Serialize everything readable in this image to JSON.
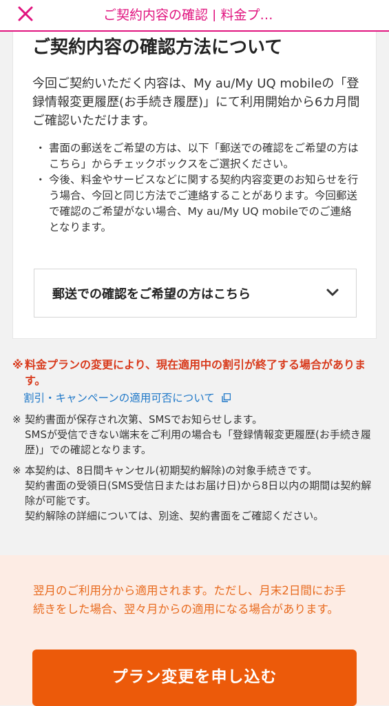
{
  "header": {
    "close_icon": "close-icon",
    "title": "ご契約内容の確認 | 料金プ…"
  },
  "card": {
    "title": "ご契約内容の確認方法について",
    "lead": "今回ご契約いただく内容は、My au/My UQ mobileの「登録情報変更履歴(お手続き履歴)」にて利用開始から6カ月間ご確認いただけます。",
    "bullets": [
      "書面の郵送をご希望の方は、以下「郵送での確認をご希望の方はこちら」からチェックボックスをご選択ください。",
      "今後、料金やサービスなどに関する契約内容変更のお知らせを行う場合、今回と同じ方法でご連絡することがあります。今回郵送で確認のご希望がない場合、My au/My UQ mobileでのご連絡となります。"
    ],
    "bullet_mark": "・",
    "accordion_label": "郵送での確認をご希望の方はこちら",
    "accordion_icon": "chevron-down-icon"
  },
  "notes": {
    "mark": "※",
    "warning": "料金プランの変更により、現在適用中の割引が終了する場合があります。",
    "link_text": "割引・キャンペーンの適用可否について",
    "link_icon": "external-link-icon",
    "items": [
      "契約書面が保存され次第、SMSでお知らせします。\nSMSが受信できない端末をご利用の場合も「登録情報変更履歴(お手続き履歴)」での確認となります。",
      "本契約は、8日間キャンセル(初期契約解除)の対象手続きです。\n契約書面の受領日(SMS受信日またはお届け日)から8日以内の期間は契約解除が可能です。\n契約解除の詳細については、別途、契約書面をご確認ください。"
    ]
  },
  "bottom": {
    "text": "翌月のご利用分から適用されます。ただし、月末2日間にお手続きをした場合、翌々月からの適用になる場合があります。",
    "cta_label": "プラン変更を申し込む"
  },
  "colors": {
    "brand": "#e0137e",
    "warning": "#d83a1c",
    "link": "#1f78c8",
    "cta": "#ec5a0a",
    "bottom_bg": "#fdece4"
  }
}
